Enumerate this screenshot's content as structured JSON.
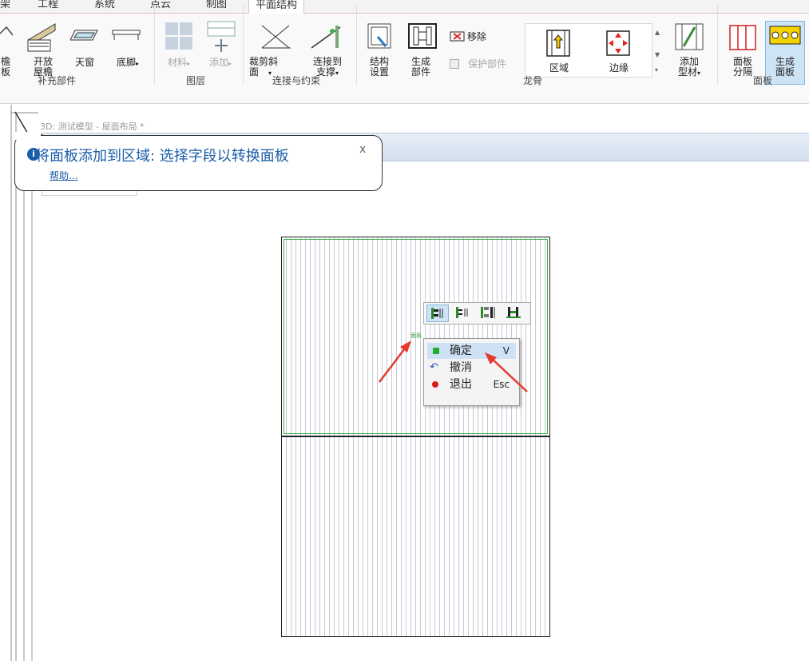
{
  "tabs": [
    {
      "label": "架",
      "active": false
    },
    {
      "label": "工程",
      "active": false
    },
    {
      "label": "系统",
      "active": false
    },
    {
      "label": "点云",
      "active": false
    },
    {
      "label": "制图",
      "active": false
    },
    {
      "label": "平面结构",
      "active": true
    }
  ],
  "ribbon": {
    "supplement": {
      "eave_l1": "檐",
      "eave_l2": "板",
      "open_eave_l1": "开放",
      "open_eave_l2": "屋檐",
      "skylight": "天窗",
      "baseboard": "底脚",
      "group": "补充部件"
    },
    "layers": {
      "material": "材料",
      "add": "添加",
      "group": "图层"
    },
    "connect": {
      "cut_bevel_l1": "裁剪斜",
      "cut_bevel_l2": "面",
      "connect_to_l1": "连接到",
      "connect_to_l2": "支撑",
      "group": "连接与约束"
    },
    "keel": {
      "struct_l1": "结构",
      "struct_l2": "设置",
      "gen_part_l1": "生成",
      "gen_part_l2": "部件",
      "remove": "移除",
      "protect": "保护部件",
      "region": "区域",
      "edge": "边缘",
      "add_profile_l1": "添加",
      "add_profile_l2": "型材",
      "group": "龙骨"
    },
    "panel": {
      "divide_l1": "面板",
      "divide_l2": "分隔",
      "generate_l1": "生成",
      "generate_l2": "面板",
      "group": "面板"
    }
  },
  "document": {
    "title": "3D: 测试模型 - 屋面布局 *"
  },
  "tooltip": {
    "message": "将面板添加到区域: 选择字段以转换面板",
    "help": "帮助...",
    "close": "x"
  },
  "canvas": {
    "tiny_label": "面板"
  },
  "context_menu": {
    "items": [
      {
        "label": "确定",
        "shortcut": "V",
        "icon": "green-square-icon"
      },
      {
        "label": "撤消",
        "shortcut": "",
        "icon": "undo-icon"
      },
      {
        "label": "退出",
        "shortcut": "Esc",
        "icon": "red-dot-icon"
      }
    ]
  },
  "colors": {
    "accent_blue": "#1a5da8",
    "panel_green": "#3bb34a",
    "arrow_red": "#e8392f",
    "tab_pink": "#e3bcd4"
  }
}
